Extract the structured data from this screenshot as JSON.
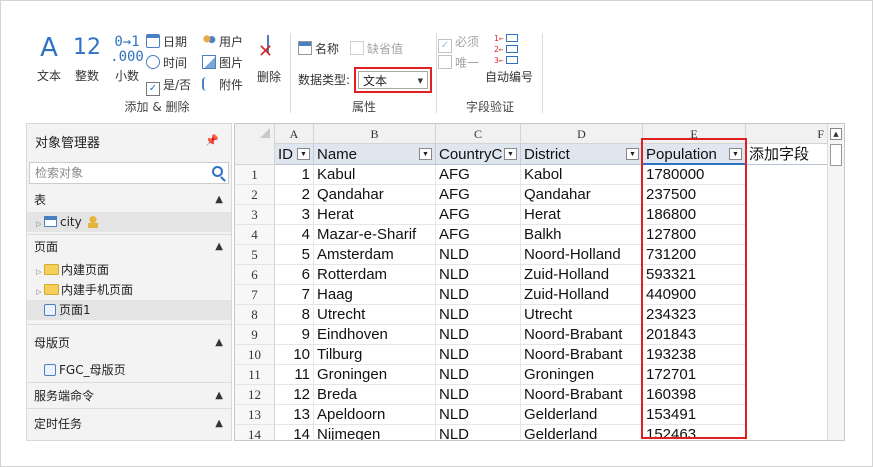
{
  "ribbon": {
    "add_delete": {
      "label": "添加 & 删除",
      "text_label": "文本",
      "int_label": "整数",
      "decimal_label": "小数",
      "date_label": "日期",
      "time_label": "时间",
      "bool_label": "是/否",
      "user_label": "用户",
      "image_label": "图片",
      "attach_label": "附件",
      "delete_label": "删除",
      "text_glyph": "A",
      "int_glyph": "12",
      "decimal_glyph_top": "0→1",
      "decimal_glyph_bottom": ".000"
    },
    "properties": {
      "label": "属性",
      "name_label": "名称",
      "default_label": "缺省值",
      "datatype_label": "数据类型:",
      "datatype_value": "文本"
    },
    "validation": {
      "label": "字段验证",
      "required_label": "必须",
      "unique_label": "唯一",
      "autonum_label": "自动编号"
    }
  },
  "object_manager": {
    "title": "对象管理器",
    "search_placeholder": "检索对象",
    "sections": {
      "tables": "表",
      "pages": "页面",
      "master": "母版页",
      "server_cmd": "服务端命令",
      "scheduled": "定时任务"
    },
    "table_items": [
      "city"
    ],
    "page_items": [
      "内建页面",
      "内建手机页面",
      "页面1"
    ],
    "master_items": [
      "FGC_母版页"
    ]
  },
  "grid": {
    "column_letters": [
      "A",
      "B",
      "C",
      "D",
      "E",
      "F"
    ],
    "fields": [
      "ID",
      "Name",
      "CountryC",
      "District",
      "Population",
      "添加字段"
    ],
    "rows": [
      {
        "n": "1",
        "id": "1",
        "name": "Kabul",
        "cc": "AFG",
        "district": "Kabol",
        "pop": "1780000"
      },
      {
        "n": "2",
        "id": "2",
        "name": "Qandahar",
        "cc": "AFG",
        "district": "Qandahar",
        "pop": "237500"
      },
      {
        "n": "3",
        "id": "3",
        "name": "Herat",
        "cc": "AFG",
        "district": "Herat",
        "pop": "186800"
      },
      {
        "n": "4",
        "id": "4",
        "name": "Mazar-e-Sharif",
        "cc": "AFG",
        "district": "Balkh",
        "pop": "127800"
      },
      {
        "n": "5",
        "id": "5",
        "name": "Amsterdam",
        "cc": "NLD",
        "district": "Noord-Holland",
        "pop": "731200"
      },
      {
        "n": "6",
        "id": "6",
        "name": "Rotterdam",
        "cc": "NLD",
        "district": "Zuid-Holland",
        "pop": "593321"
      },
      {
        "n": "7",
        "id": "7",
        "name": "Haag",
        "cc": "NLD",
        "district": "Zuid-Holland",
        "pop": "440900"
      },
      {
        "n": "8",
        "id": "8",
        "name": "Utrecht",
        "cc": "NLD",
        "district": "Utrecht",
        "pop": "234323"
      },
      {
        "n": "9",
        "id": "9",
        "name": "Eindhoven",
        "cc": "NLD",
        "district": "Noord-Brabant",
        "pop": "201843"
      },
      {
        "n": "10",
        "id": "10",
        "name": "Tilburg",
        "cc": "NLD",
        "district": "Noord-Brabant",
        "pop": "193238"
      },
      {
        "n": "11",
        "id": "11",
        "name": "Groningen",
        "cc": "NLD",
        "district": "Groningen",
        "pop": "172701"
      },
      {
        "n": "12",
        "id": "12",
        "name": "Breda",
        "cc": "NLD",
        "district": "Noord-Brabant",
        "pop": "160398"
      },
      {
        "n": "13",
        "id": "13",
        "name": "Apeldoorn",
        "cc": "NLD",
        "district": "Gelderland",
        "pop": "153491"
      },
      {
        "n": "14",
        "id": "14",
        "name": "Nijmegen",
        "cc": "NLD",
        "district": "Gelderland",
        "pop": "152463"
      }
    ]
  },
  "colors": {
    "accent": "#2f72c4",
    "highlight": "#e02020",
    "field_header_bg": "#dfe6f0"
  }
}
